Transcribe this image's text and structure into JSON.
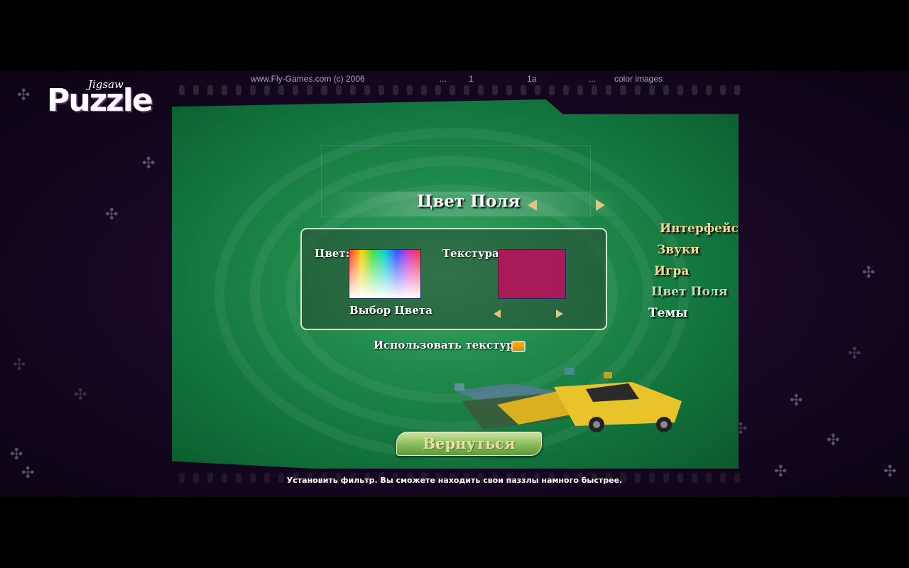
{
  "header": {
    "logo_small": "Jigsaw",
    "logo_big": "Puzzle",
    "copyright": "www.Fly-Games.com (c) 2006",
    "dots1": "...",
    "num1": "1",
    "num2": "1a",
    "dots2": "...",
    "mode": "color images"
  },
  "settings": {
    "title": "Цвет Поля",
    "color_label": "Цвет:",
    "texture_label": "Текстура:",
    "color_pick_label": "Выбор Цвета",
    "use_texture_label": "Использовать текстуру:",
    "texture_color": "#a81a58"
  },
  "menu": {
    "items": [
      {
        "label": "Интерфейс"
      },
      {
        "label": "Звуки"
      },
      {
        "label": "Игра"
      },
      {
        "label": "Цвет Поля"
      },
      {
        "label": "Темы"
      }
    ]
  },
  "back_button": "Вернуться",
  "status": "Установить фильтр. Вы сможете находить свои паззлы намного быстрее."
}
